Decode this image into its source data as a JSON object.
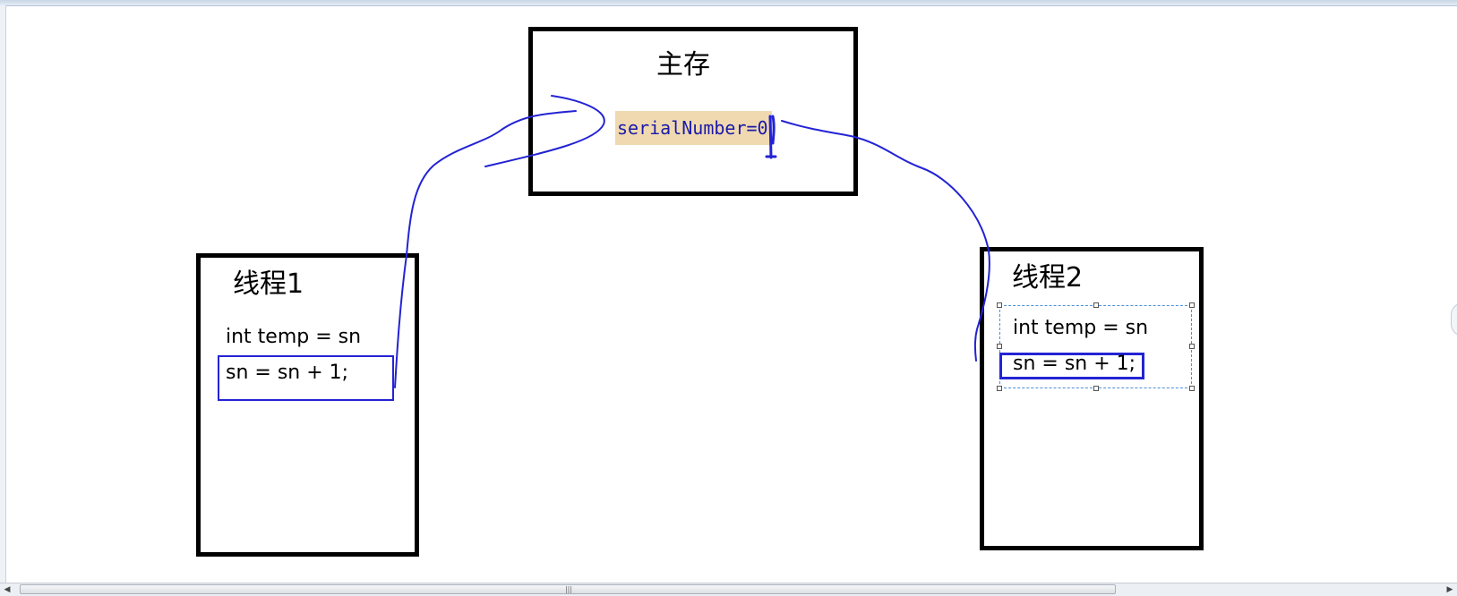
{
  "diagram": {
    "main_memory": {
      "title": "主存",
      "variable": "serialNumber=0"
    },
    "thread1": {
      "title": "线程1",
      "line1": "int temp = sn",
      "line2": "sn = sn + 1;"
    },
    "thread2": {
      "title": "线程2",
      "line1": "int temp = sn",
      "line2": "sn = sn + 1;"
    }
  },
  "colors": {
    "box_border": "#000000",
    "annotation": "#2323d4",
    "variable_highlight": "#f0d9b0",
    "variable_text": "#1a1aa8",
    "selection": "#4a90d9"
  },
  "scrollbar": {
    "left_arrow": "◀",
    "right_arrow": "▶",
    "grip": "|||"
  }
}
